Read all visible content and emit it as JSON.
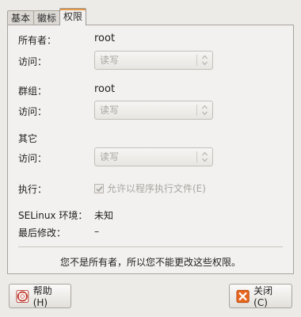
{
  "tabs": [
    {
      "label": "基本"
    },
    {
      "label": "徽标"
    },
    {
      "label": "权限"
    }
  ],
  "owner": {
    "label": "所有者：",
    "value": "root",
    "access_label": "访问：",
    "access_value": "读写"
  },
  "group": {
    "label": "群组：",
    "value": "root",
    "access_label": "访问：",
    "access_value": "读写"
  },
  "others": {
    "label": "其它",
    "access_label": "访问：",
    "access_value": "读写"
  },
  "execute": {
    "label": "执行：",
    "checkbox_label": "允许以程序执行文件(E)",
    "checked": true
  },
  "selinux": {
    "label": "SELinux 环境：",
    "value": "未知"
  },
  "modified": {
    "label": "最后修改：",
    "value": "–"
  },
  "notice": "您不是所有者，所以您不能更改这些权限。",
  "buttons": {
    "help": "帮助(H)",
    "close": "关闭(C)"
  },
  "colors": {
    "background": "#edebe8",
    "active_tab_accent": "#e69a4a",
    "disabled_text": "#a8a6a2",
    "close_icon": "#e05a1a"
  },
  "icons": {
    "help": "lifebuoy-icon",
    "close": "close-x-icon",
    "combo": "updown-arrows-icon",
    "check": "check-icon"
  }
}
